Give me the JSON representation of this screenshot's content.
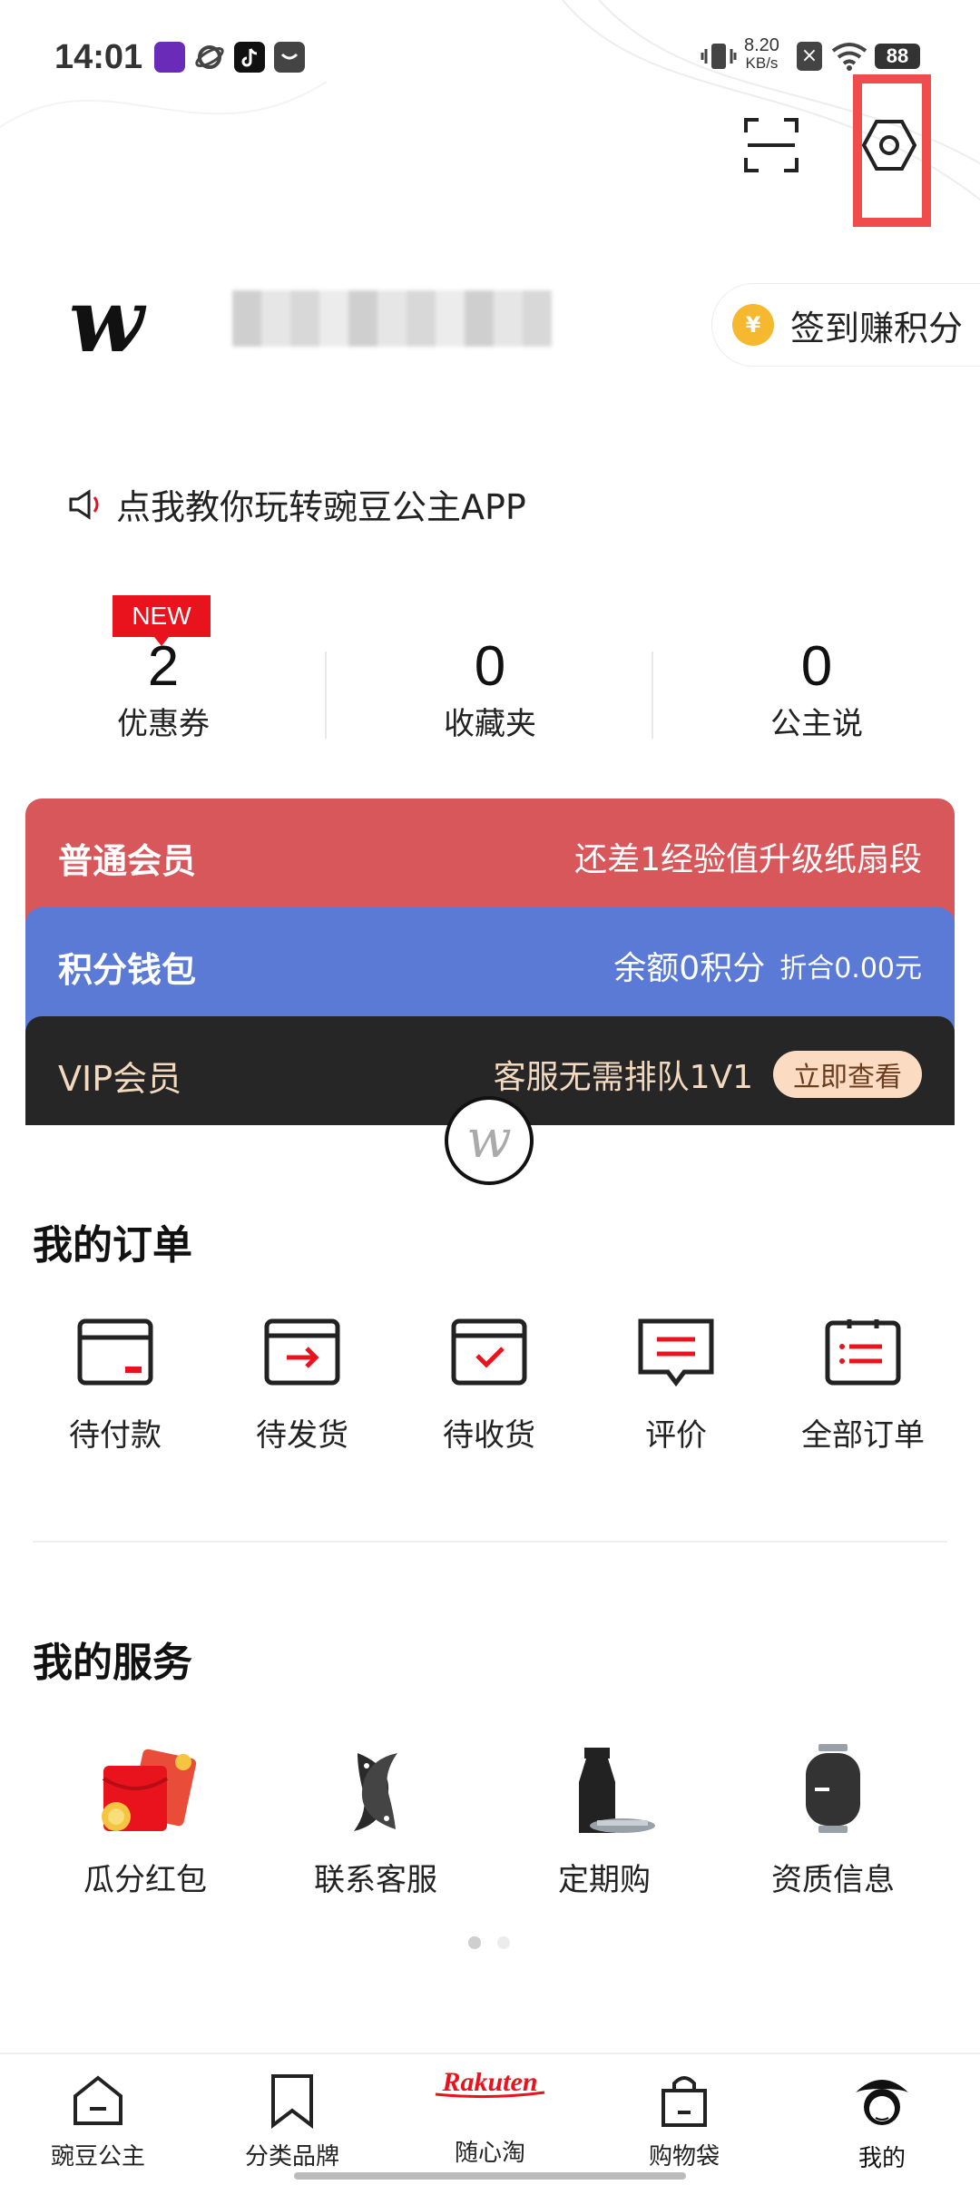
{
  "status_bar": {
    "time": "14:01",
    "net_speed_top": "8.20",
    "net_speed_bottom": "KB/s",
    "battery": "88"
  },
  "profile": {
    "logo_letter": "w",
    "signin_label": "签到赚积分",
    "coin_symbol": "¥"
  },
  "tip": {
    "text": "点我教你玩转豌豆公主APP"
  },
  "stats": {
    "new_badge": "NEW",
    "items": [
      {
        "value": "2",
        "label": "优惠券"
      },
      {
        "value": "0",
        "label": "收藏夹"
      },
      {
        "value": "0",
        "label": "公主说"
      }
    ]
  },
  "cards": {
    "member": {
      "title": "普通会员",
      "info": "还差1经验值升级纸扇段"
    },
    "wallet": {
      "title": "积分钱包",
      "balance": "余额0积分",
      "value": "折合0.00元"
    },
    "vip": {
      "title": "VIP会员",
      "info": "客服无需排队1V1",
      "button": "立即查看"
    }
  },
  "orders": {
    "title": "我的订单",
    "items": [
      {
        "label": "待付款",
        "icon": "wallet-card-icon"
      },
      {
        "label": "待发货",
        "icon": "box-arrow-icon"
      },
      {
        "label": "待收货",
        "icon": "box-check-icon"
      },
      {
        "label": "评价",
        "icon": "comment-icon"
      },
      {
        "label": "全部订单",
        "icon": "clipboard-list-icon"
      }
    ]
  },
  "services": {
    "title": "我的服务",
    "items": [
      {
        "label": "瓜分红包",
        "icon": "red-envelope-icon"
      },
      {
        "label": "联系客服",
        "icon": "koi-fish-icon"
      },
      {
        "label": "定期购",
        "icon": "soy-bottle-icon"
      },
      {
        "label": "资质信息",
        "icon": "lantern-icon"
      }
    ]
  },
  "nav": {
    "items": [
      {
        "label": "豌豆公主",
        "icon": "home-icon"
      },
      {
        "label": "分类品牌",
        "icon": "bookmark-icon"
      },
      {
        "label": "随心淘",
        "icon": "rakuten-icon"
      },
      {
        "label": "购物袋",
        "icon": "shopping-bag-icon"
      },
      {
        "label": "我的",
        "icon": "princess-avatar-icon"
      }
    ],
    "rakuten_text": "Rakuten"
  },
  "colors": {
    "member_card": "#d8575a",
    "wallet_card": "#5a7ad6",
    "vip_card": "#262626",
    "accent_red": "#e8131d",
    "highlight_box": "#f04c4c"
  }
}
